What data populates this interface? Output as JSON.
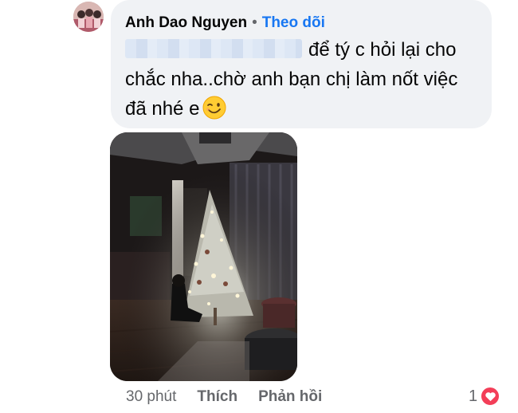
{
  "comment": {
    "author": "Anh Dao Nguyen",
    "separator": "•",
    "follow_label": "Theo dõi",
    "text_line1": "để tý c hỏi lại cho",
    "text_line2": "chắc nha..chờ anh bạn chị làm nốt việc",
    "text_line3": "đã nhé e"
  },
  "icons": {
    "emoji": "winking-face-icon",
    "reaction": "heart-icon",
    "photo": "christmas-tree-photo"
  },
  "footer": {
    "timestamp": "30 phút",
    "like_label": "Thích",
    "reply_label": "Phản hồi",
    "reaction_count": "1"
  },
  "colors": {
    "bubble": "#f0f2f5",
    "link": "#1877f2",
    "muted": "#65676b",
    "heart": "#f33e58"
  }
}
